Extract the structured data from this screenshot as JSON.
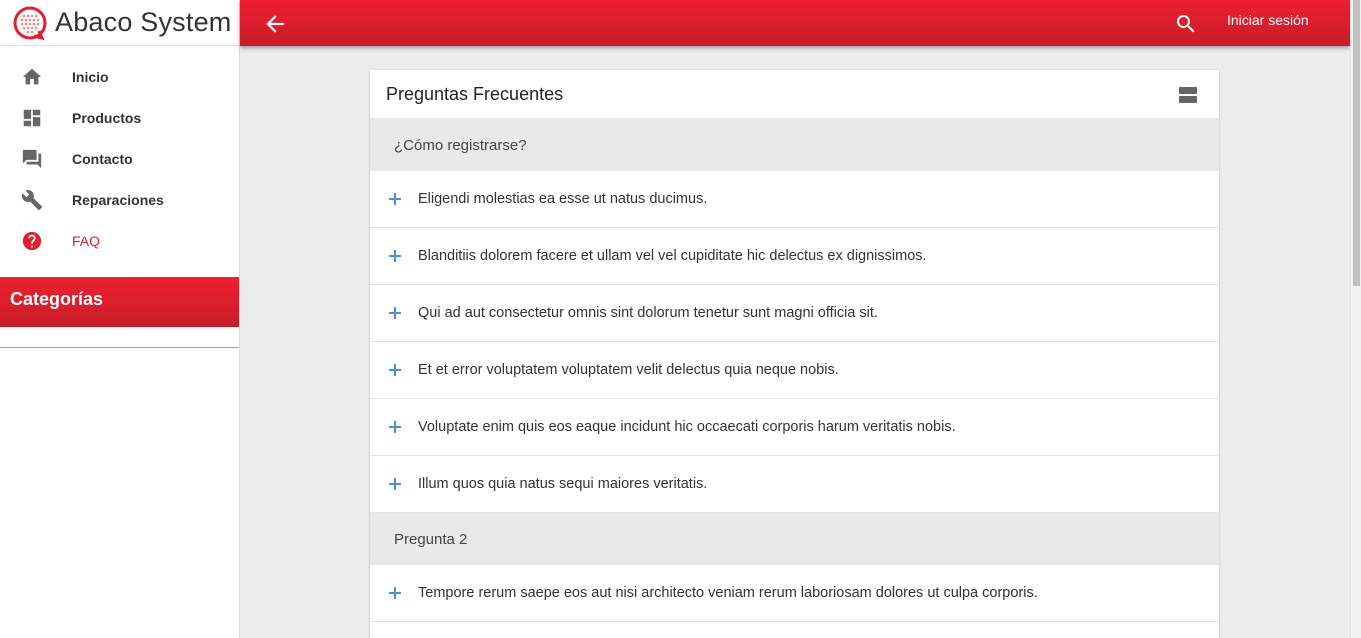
{
  "brand": {
    "name": "Abaco System"
  },
  "sidebar": {
    "items": [
      {
        "label": "Inicio",
        "icon": "home-icon"
      },
      {
        "label": "Productos",
        "icon": "dashboard-icon"
      },
      {
        "label": "Contacto",
        "icon": "forum-icon"
      },
      {
        "label": "Reparaciones",
        "icon": "wrench-icon"
      },
      {
        "label": "FAQ",
        "icon": "help-circle-icon",
        "active": true
      }
    ],
    "categories_title": "Categorías"
  },
  "topbar": {
    "login_label": "Iniciar sesión"
  },
  "faq": {
    "title": "Preguntas Frecuentes",
    "sections": [
      {
        "title": "¿Cómo registrarse?",
        "questions": [
          "Eligendi molestias ea esse ut natus ducimus.",
          "Blanditiis dolorem facere et ullam vel vel cupiditate hic delectus ex dignissimos.",
          "Qui ad aut consectetur omnis sint dolorum tenetur sunt magni officia sit.",
          "Et et error voluptatem voluptatem velit delectus quia neque nobis.",
          "Voluptate enim quis eos eaque incidunt hic occaecati corporis harum veritatis nobis.",
          "Illum quos quia natus sequi maiores veritatis."
        ]
      },
      {
        "title": "Pregunta 2",
        "questions": [
          "Tempore rerum saepe eos aut nisi architecto veniam rerum laboriosam dolores ut culpa corporis."
        ]
      }
    ]
  },
  "colors": {
    "accent": "#e41f2d",
    "link_blue": "#4a8fdc"
  }
}
